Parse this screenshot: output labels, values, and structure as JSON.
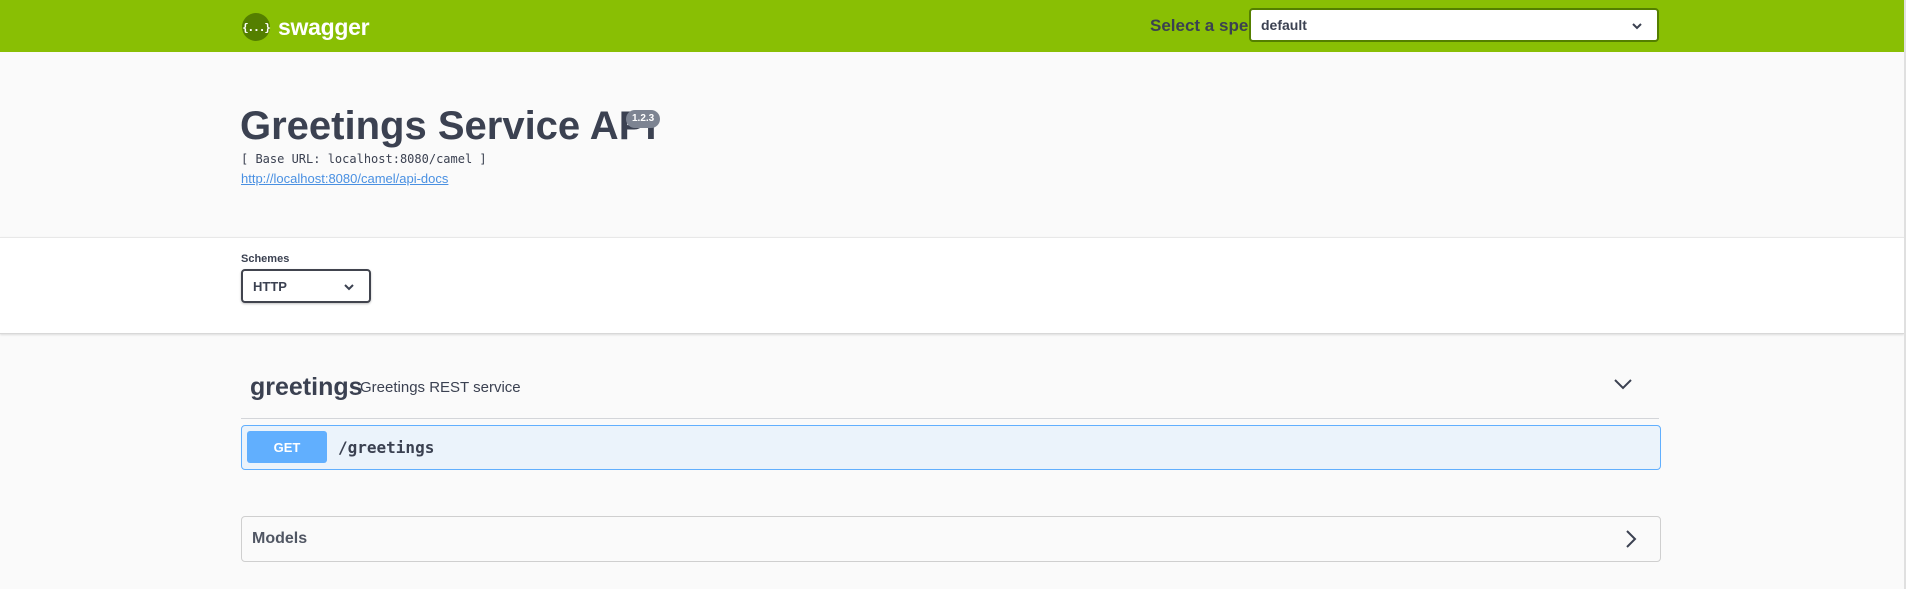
{
  "topbar": {
    "logo_glyph": "{...}",
    "logo_text": "swagger",
    "spec_label": "Select a spec",
    "spec_selected": "default",
    "brand_color": "#89bf04"
  },
  "info": {
    "title": "Greetings Service API",
    "version": "1.2.3",
    "base_url": "[ Base URL: localhost:8080/camel ]",
    "docs_link": "http://localhost:8080/camel/api-docs"
  },
  "schemes": {
    "label": "Schemes",
    "selected": "HTTP"
  },
  "tag": {
    "name": "greetings",
    "description": "Greetings REST service",
    "toggle_icon": "chevron-down-icon"
  },
  "operations": [
    {
      "method": "GET",
      "path": "/greetings",
      "method_color": "#61affe"
    }
  ],
  "models": {
    "title": "Models",
    "toggle_icon": "chevron-right-icon"
  }
}
